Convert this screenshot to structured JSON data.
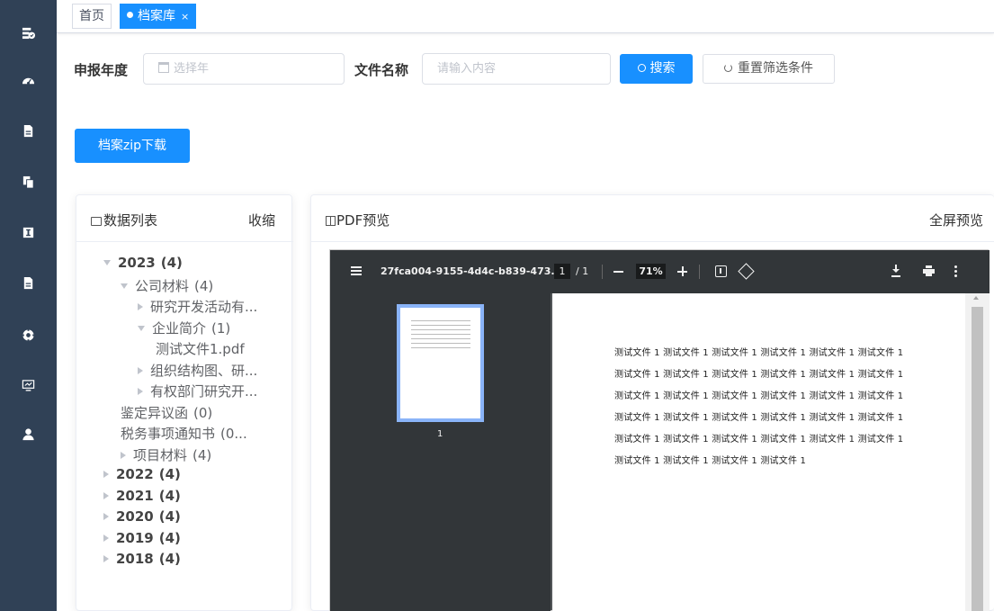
{
  "sidebar": {
    "items": [
      {
        "icon": "logo-icon"
      },
      {
        "icon": "dashboard-icon"
      },
      {
        "icon": "document-icon"
      },
      {
        "icon": "copy-icon"
      },
      {
        "icon": "info-icon"
      },
      {
        "icon": "file-icon"
      },
      {
        "icon": "settings-icon"
      },
      {
        "icon": "monitor-icon"
      },
      {
        "icon": "user-icon"
      }
    ]
  },
  "tabs": [
    {
      "label": "首页",
      "active": false
    },
    {
      "label": "档案库",
      "active": true,
      "close": "×"
    }
  ],
  "filters": {
    "year_label": "申报年度",
    "year_placeholder": "选择年",
    "name_label": "文件名称",
    "name_placeholder": "请输入内容",
    "search_label": "搜索",
    "reset_label": "重置筛选条件"
  },
  "download_label": "档案zip下载",
  "list_panel": {
    "title": "数据列表",
    "collapse_label": "收缩",
    "tree": [
      {
        "label": "2023",
        "count": "(4)",
        "level": 0,
        "state": "down"
      },
      {
        "label": "公司材料",
        "count": "(4)",
        "level": 1,
        "state": "down"
      },
      {
        "label": "研究开发活动有...",
        "count": "",
        "level": 2,
        "state": "right"
      },
      {
        "label": "企业简介",
        "count": "(1)",
        "level": 2,
        "state": "down"
      },
      {
        "label": "测试文件1.pdf",
        "count": "",
        "level": 3,
        "state": "none"
      },
      {
        "label": "组织结构图、研...",
        "count": "",
        "level": 2,
        "state": "right"
      },
      {
        "label": "有权部门研究开...",
        "count": "",
        "level": 2,
        "state": "right"
      },
      {
        "label": "鉴定异议函",
        "count": "(0)",
        "level": 1,
        "state": "none"
      },
      {
        "label": "税务事项通知书",
        "count": "(0...",
        "level": 1,
        "state": "none"
      },
      {
        "label": "项目材料",
        "count": "(4)",
        "level": 1,
        "state": "right"
      },
      {
        "label": "2022",
        "count": "(4)",
        "level": 0,
        "state": "right"
      },
      {
        "label": "2021",
        "count": "(4)",
        "level": 0,
        "state": "right"
      },
      {
        "label": "2020",
        "count": "(4)",
        "level": 0,
        "state": "right"
      },
      {
        "label": "2019",
        "count": "(4)",
        "level": 0,
        "state": "right"
      },
      {
        "label": "2018",
        "count": "(4)",
        "level": 0,
        "state": "right"
      }
    ]
  },
  "preview_panel": {
    "title": "PDF预览",
    "fullscreen_label": "全屏预览"
  },
  "pdf_viewer": {
    "filename": "27fca004-9155-4d4c-b839-473...",
    "page_current": "1",
    "page_total": "/ 1",
    "zoom": "71%",
    "thumb_page_number": "1",
    "document_lines": [
      "测试文件 1 测试文件 1 测试文件 1 测试文件 1 测试文件 1 测试文件 1",
      "测试文件 1 测试文件 1 测试文件 1 测试文件 1 测试文件 1 测试文件 1",
      "测试文件 1 测试文件 1 测试文件 1 测试文件 1 测试文件 1 测试文件 1",
      "测试文件 1 测试文件 1 测试文件 1 测试文件 1 测试文件 1 测试文件 1",
      "测试文件 1 测试文件 1 测试文件 1 测试文件 1 测试文件 1 测试文件 1",
      "测试文件 1 测试文件 1 测试文件 1 测试文件 1"
    ]
  },
  "colors": {
    "sidebar_bg": "#304156",
    "primary": "#1890ff",
    "viewer_toolbar": "#323639"
  }
}
